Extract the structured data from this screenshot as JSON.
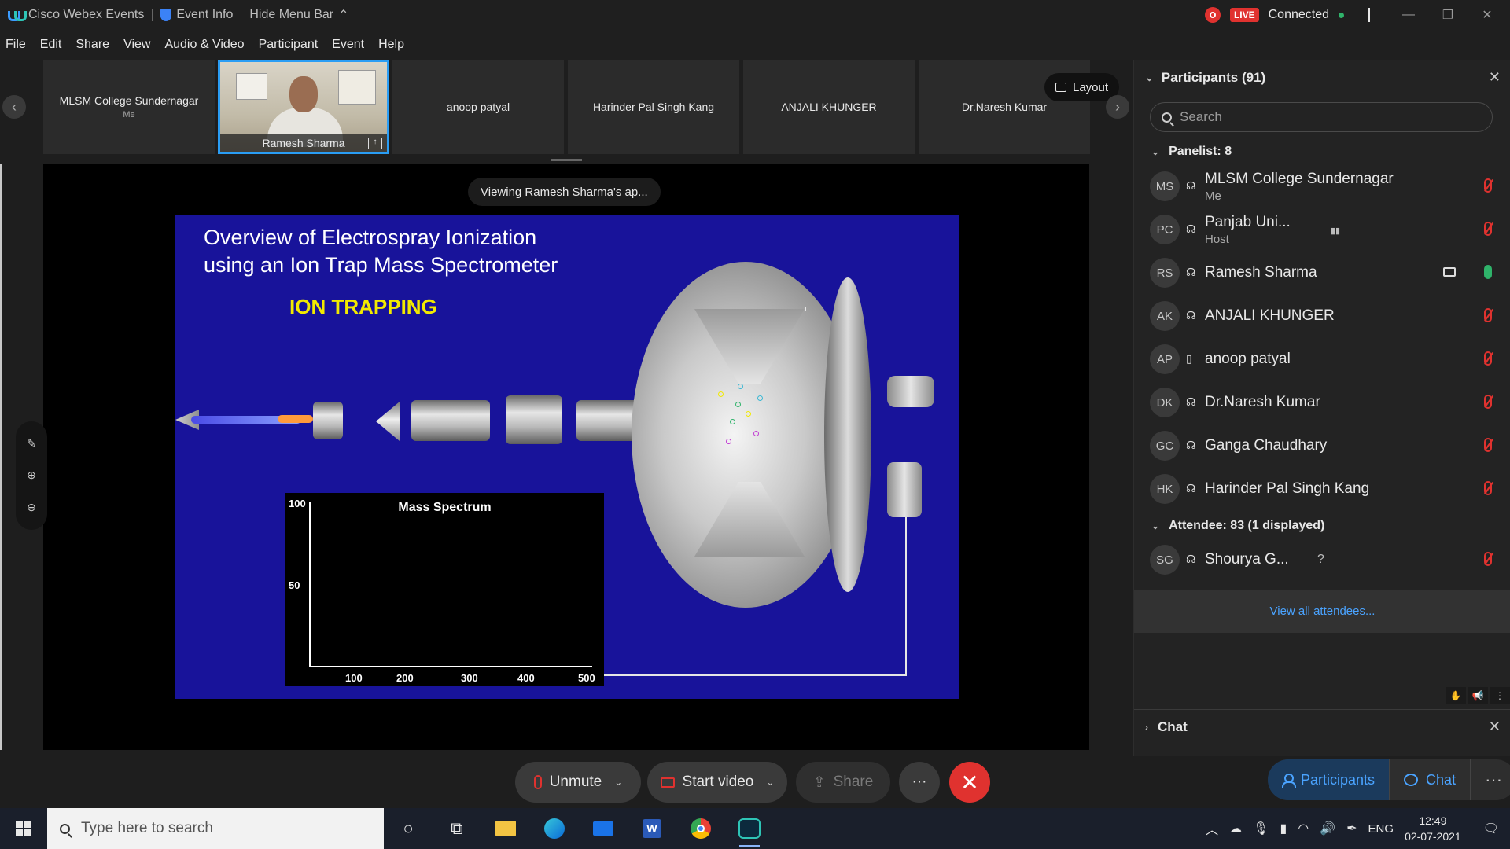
{
  "titlebar": {
    "app_name": "Cisco Webex Events",
    "event_info": "Event Info",
    "hide_menu": "Hide Menu Bar",
    "live": "LIVE",
    "connection": "Connected"
  },
  "menu": [
    "File",
    "Edit",
    "Share",
    "View",
    "Audio & Video",
    "Participant",
    "Event",
    "Help"
  ],
  "strip": {
    "tiles": [
      {
        "name": "MLSM College Sundernagar",
        "sub": "Me"
      },
      {
        "name": "Ramesh Sharma",
        "sub": ""
      },
      {
        "name": "anoop patyal",
        "sub": ""
      },
      {
        "name": "Harinder Pal Singh Kang",
        "sub": ""
      },
      {
        "name": "ANJALI KHUNGER",
        "sub": ""
      },
      {
        "name": "Dr.Naresh Kumar",
        "sub": ""
      }
    ],
    "layout_label": "Layout"
  },
  "stage": {
    "viewing_label": "Viewing Ramesh Sharma's ap..."
  },
  "slide": {
    "title_line1": "Overview of Electrospray Ionization",
    "title_line2": "using an Ion Trap Mass Spectrometer",
    "subtitle": "ION TRAPPING",
    "spectrum_title": "Mass Spectrum",
    "y_ticks": [
      "100",
      "50"
    ],
    "x_ticks": [
      "100",
      "200",
      "300",
      "400",
      "500"
    ]
  },
  "controls": {
    "unmute": "Unmute",
    "start_video": "Start video",
    "share": "Share",
    "more": "···",
    "end": "✕"
  },
  "panel": {
    "title": "Participants (91)",
    "search_placeholder": "Search",
    "panelist_header": "Panelist: 8",
    "attendee_header": "Attendee: 83 (1 displayed)",
    "panelists": [
      {
        "initials": "MS",
        "name": "MLSM College Sundernagar",
        "role": "Me"
      },
      {
        "initials": "PC",
        "name": "Panjab Uni...",
        "role": "Host"
      },
      {
        "initials": "RS",
        "name": "Ramesh Sharma",
        "role": ""
      },
      {
        "initials": "AK",
        "name": "ANJALI KHUNGER",
        "role": ""
      },
      {
        "initials": "AP",
        "name": "anoop patyal",
        "role": ""
      },
      {
        "initials": "DK",
        "name": "Dr.Naresh Kumar",
        "role": ""
      },
      {
        "initials": "GC",
        "name": "Ganga Chaudhary",
        "role": ""
      },
      {
        "initials": "HK",
        "name": "Harinder Pal Singh Kang",
        "role": ""
      }
    ],
    "attendees": [
      {
        "initials": "SG",
        "name": "Shourya G...",
        "role": ""
      }
    ],
    "view_all": "View all attendees...",
    "chat_header": "Chat",
    "btn_participants": "Participants",
    "btn_chat": "Chat"
  },
  "taskbar": {
    "search_placeholder": "Type here to search",
    "lang": "ENG",
    "time": "12:49",
    "date": "02-07-2021"
  },
  "colors": {
    "accent": "#2a9df4",
    "danger": "#e0322f",
    "slide_bg": "#18139a",
    "slide_subtitle": "#f2ea00"
  }
}
